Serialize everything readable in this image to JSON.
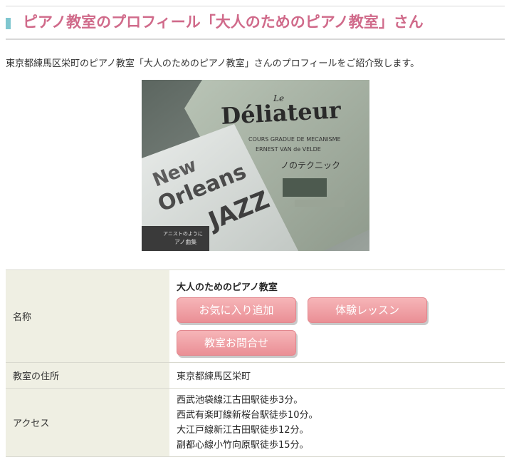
{
  "header": {
    "title": "ピアノ教室のプロフィール「大人のためのピアノ教室」さん"
  },
  "intro": "東京都練馬区栄町のピアノ教室「大人のためのピアノ教室」さんのプロフィールをご紹介致します。",
  "photo": {
    "book_back_title": "Déliateur",
    "book_back_small": "Le",
    "book_back_subtitle": "COURS GRADUE DE MECANISME",
    "book_back_author": "ERNEST VAN de VELDE",
    "book_back_jp": "ノのテクニック",
    "book_front_title_1": "New",
    "book_front_title_2": "Orleans",
    "book_front_title_3": "JAZZ",
    "book_front_caption": "アニストのように",
    "book_front_caption_2": "アノ曲集"
  },
  "table": {
    "name_label": "名称",
    "school_name": "大人のためのピアノ教室",
    "buttons": {
      "favorite": "お気に入り追加",
      "trial": "体験レッスン",
      "contact": "教室お問合せ"
    },
    "address_label": "教室の住所",
    "address_value": "東京都練馬区栄町",
    "access_label": "アクセス",
    "access_lines": [
      "西武池袋線江古田駅徒歩3分。",
      "西武有楽町線新桜台駅徒歩10分。",
      "大江戸線新江古田駅徒歩12分。",
      "副都心線小竹向原駅徒歩15分。"
    ]
  }
}
